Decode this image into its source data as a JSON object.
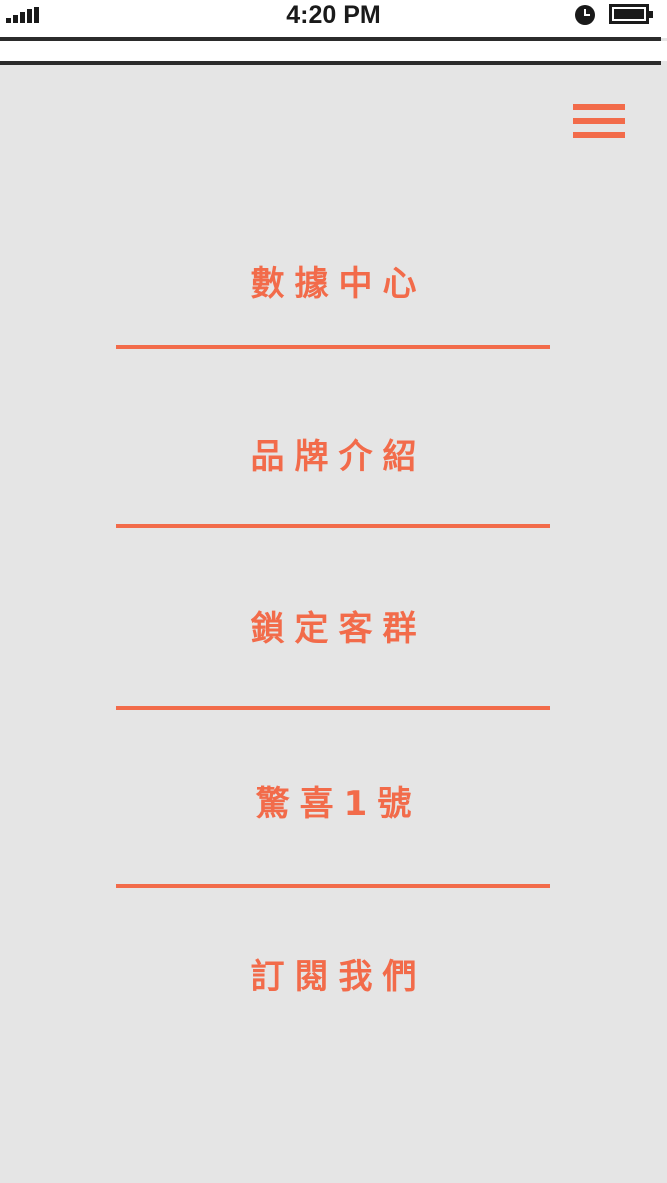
{
  "status_bar": {
    "time": "4:20 PM",
    "signal_icon": "signal-bars-icon",
    "alarm_icon": "alarm-clock-icon",
    "battery_icon": "battery-full-icon"
  },
  "header": {
    "menu_icon": "hamburger-menu-icon"
  },
  "nav": {
    "items": [
      {
        "label": "數據中心"
      },
      {
        "label": "品牌介紹"
      },
      {
        "label": "鎖定客群"
      },
      {
        "label": "驚喜1號"
      },
      {
        "label": "訂閱我們"
      }
    ]
  },
  "colors": {
    "accent": "#f26b4a",
    "background": "#e5e5e5",
    "status_text": "#1a1a1a"
  }
}
